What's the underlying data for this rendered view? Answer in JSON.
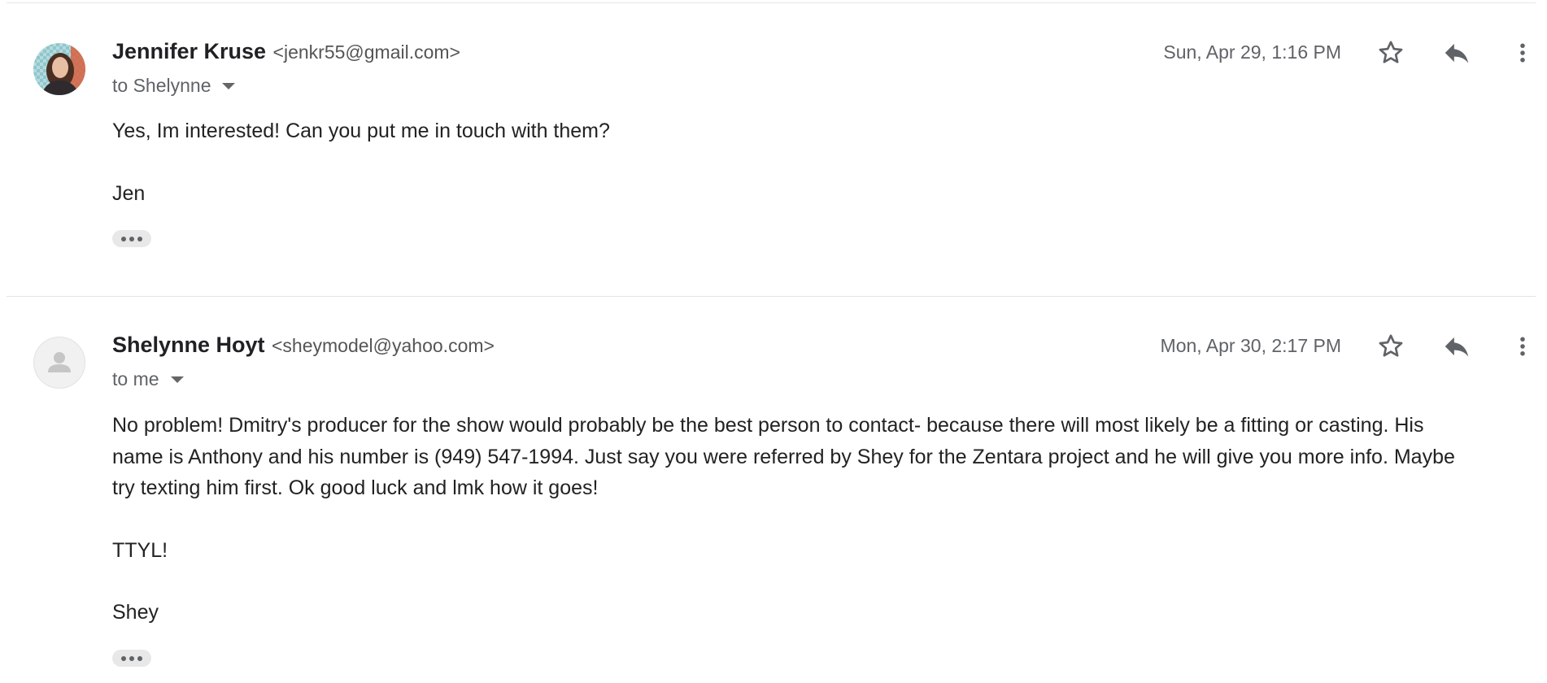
{
  "messages": [
    {
      "sender_name": "Jennifer Kruse",
      "sender_email": "<jenkr55@gmail.com>",
      "recipient": "to Shelynne",
      "date": "Sun, Apr 29, 1:16 PM",
      "avatar_icon": "user-photo-icon",
      "body": {
        "line1": "Yes, Im interested! Can you put me in touch with them?",
        "signature": "Jen"
      }
    },
    {
      "sender_name": "Shelynne Hoyt",
      "sender_email": "<sheymodel@yahoo.com>",
      "recipient": "to me",
      "date": "Mon, Apr 30, 2:17 PM",
      "avatar_icon": "default-person-icon",
      "body": {
        "line1": "No problem!  Dmitry's producer for the show would probably be the best person to contact- because there will most likely be a fitting or casting.  His",
        "line2": "name is Anthony and his number is (949) 547-1994.  Just say you were referred by Shey for the Zentara project and he will give you more info.  Maybe",
        "line3": "try texting him first.  Ok good luck and lmk how it goes!",
        "closing": "TTYL!",
        "signature": "Shey"
      }
    }
  ],
  "icons": {
    "star": "star-icon",
    "reply": "reply-icon",
    "more": "more-vert-icon",
    "expand": "ellipsis-icon"
  },
  "colors": {
    "text": "#222222",
    "secondary_text": "#5f6368",
    "icon": "#5f6368",
    "divider": "#e6e6e6",
    "ellipsis_bg": "#e8e8e8"
  }
}
